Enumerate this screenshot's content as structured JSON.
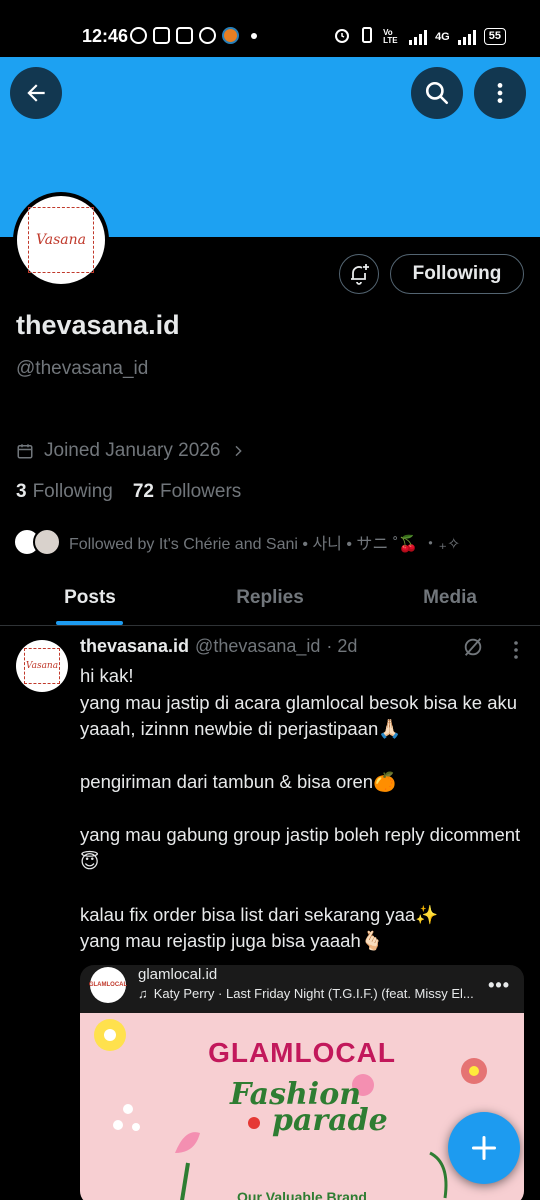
{
  "status_bar": {
    "time": "12:46",
    "network": "4G",
    "volte": "Vo LTE",
    "battery": "55"
  },
  "profile": {
    "banner_color": "#1da1f2",
    "avatar_logo_text": "Vasana",
    "name": "thevasana.id",
    "handle": "@thevasana_id",
    "joined": "Joined January 2026",
    "following_count": "3",
    "following_label": "Following",
    "followers_count": "72",
    "followers_label": "Followers",
    "followed_by": "Followed by It's Chérie and Sani • 사니 • サニ ˚🍒 ・₊✧",
    "follow_button_label": "Following"
  },
  "tabs": [
    "Posts",
    "Replies",
    "Media"
  ],
  "active_tab": "Posts",
  "post": {
    "author_name": "thevasana.id",
    "author_handle": "@thevasana_id",
    "time": "· 2d",
    "text": "hi kak!\nyang mau jastip di acara glamlocal besok bisa ke aku yaaah, izinnn newbie di perjastipaan🙏🏻\n\npengiriman dari tambun & bisa oren🍊\n\nyang mau gabung group jastip boleh reply dicomment😇\n\nkalau fix order bisa list dari sekarang yaa✨\nyang mau rejastip juga bisa yaaah🫰🏻",
    "embed": {
      "account": "glamlocal.id",
      "song": "Katy Perry · Last Friday Night (T.G.I.F.) (feat. Missy El...",
      "poster_brand": "GLAMLOCAL",
      "poster_script_1": "Fashion",
      "poster_script_2": "parade",
      "poster_footer": "Our Valuable Brand"
    }
  },
  "colors": {
    "accent": "#1d9bf0",
    "background": "#000000",
    "muted_text": "#71767b",
    "primary_text": "#e7e9ea"
  }
}
